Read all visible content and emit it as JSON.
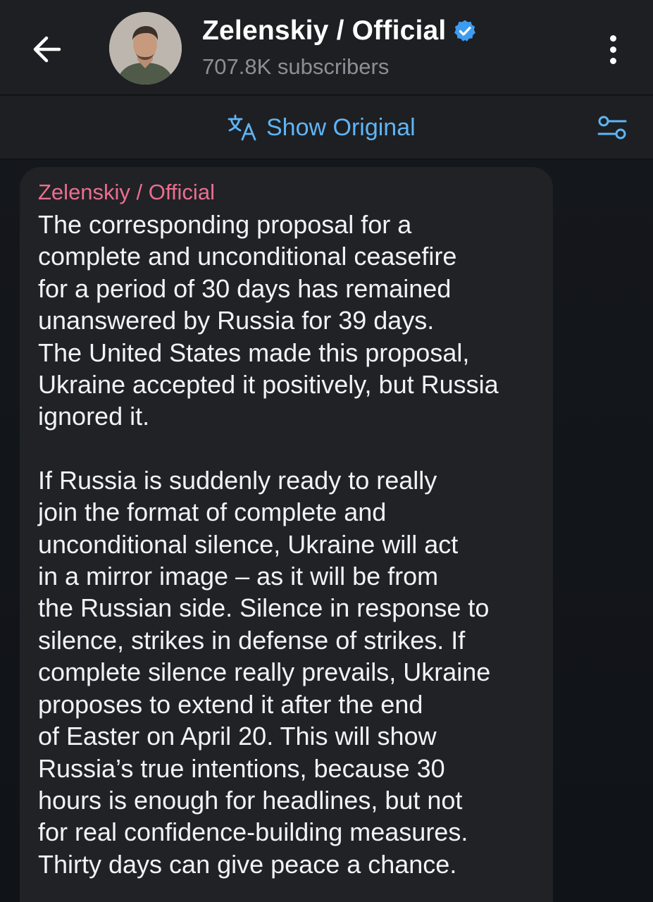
{
  "header": {
    "channel_name": "Zelenskiy / Official",
    "subscribers": "707.8K subscribers"
  },
  "translation_bar": {
    "show_original_label": "Show Original"
  },
  "message": {
    "sender": "Zelenskiy / Official",
    "paragraphs": [
      [
        "The corresponding proposal for a",
        "complete and unconditional ceasefire",
        "for a period of 30 days has remained",
        "unanswered by Russia for 39 days.",
        "The United States made this proposal,",
        "Ukraine accepted it positively, but Russia",
        "ignored it."
      ],
      [
        "If Russia is suddenly ready to really",
        "join the format of complete and",
        "unconditional silence, Ukraine will act",
        "in a mirror image – as it will be from",
        "the Russian side. Silence in response to",
        "silence, strikes in defense of strikes. If",
        "complete silence really prevails, Ukraine",
        "proposes to extend it after the end",
        "of Easter on April 20. This will show",
        "Russia’s true intentions, because 30",
        "hours is enough for headlines, but not",
        "for real confidence-building measures.",
        "Thirty days can give peace a chance."
      ]
    ]
  },
  "icons": {
    "back": "arrow-left-icon",
    "verified": "verified-badge-icon",
    "menu": "more-vertical-icon",
    "translate": "translate-icon",
    "settings": "sliders-icon"
  },
  "colors": {
    "accent_link": "#5eb5f7",
    "sender_name": "#ea6f8e",
    "verified_badge": "#3e9cf0",
    "header_bg": "#1e1f22",
    "bubble_bg": "#212226"
  }
}
